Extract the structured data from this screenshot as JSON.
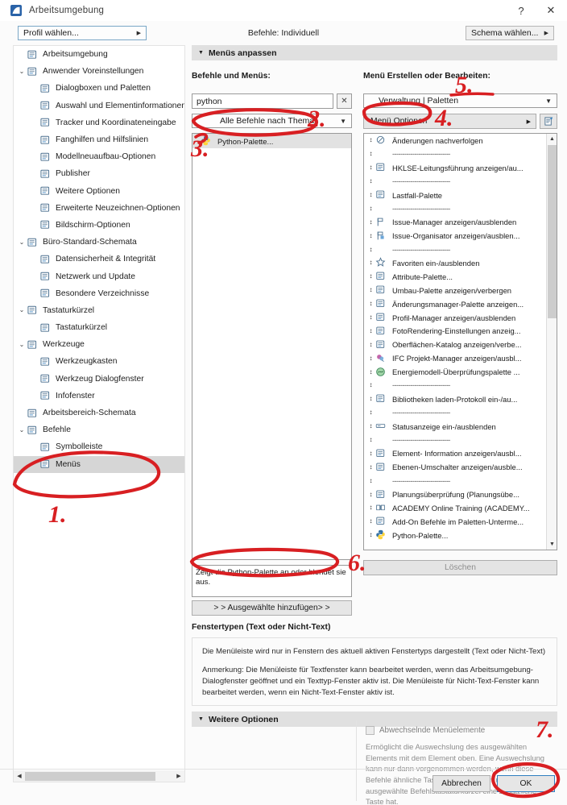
{
  "window": {
    "title": "Arbeitsumgebung",
    "icon": "archicad-app-icon",
    "help_label": "?",
    "close_label": "✕"
  },
  "topbar": {
    "profile_button": "Profil wählen...",
    "center_label": "Befehle:  Individuell",
    "schema_button": "Schema wählen..."
  },
  "tree": [
    {
      "label": "Arbeitsumgebung",
      "depth": 0,
      "twisty": "",
      "icon": "workspace-icon",
      "selected": false
    },
    {
      "label": "Anwender Voreinstellungen",
      "depth": 0,
      "twisty": "⌄",
      "icon": "user-prefs-icon",
      "selected": false
    },
    {
      "label": "Dialogboxen und Paletten",
      "depth": 1,
      "twisty": "",
      "icon": "dialogs-palettes-icon",
      "selected": false
    },
    {
      "label": "Auswahl und Elementinformationen",
      "depth": 1,
      "twisty": "",
      "icon": "selection-info-icon",
      "selected": false
    },
    {
      "label": "Tracker und Koordinateneingabe",
      "depth": 1,
      "twisty": "",
      "icon": "tracker-icon",
      "selected": false
    },
    {
      "label": "Fanghilfen und Hilfslinien",
      "depth": 1,
      "twisty": "",
      "icon": "snap-guides-icon",
      "selected": false
    },
    {
      "label": "Modellneuaufbau-Optionen",
      "depth": 1,
      "twisty": "",
      "icon": "rebuild-options-icon",
      "selected": false
    },
    {
      "label": "Publisher",
      "depth": 1,
      "twisty": "",
      "icon": "publisher-icon",
      "selected": false
    },
    {
      "label": "Weitere Optionen",
      "depth": 1,
      "twisty": "",
      "icon": "more-options-icon",
      "selected": false
    },
    {
      "label": "Erweiterte Neuzeichnen-Optionen",
      "depth": 1,
      "twisty": "",
      "icon": "advanced-redraw-icon",
      "selected": false
    },
    {
      "label": "Bildschirm-Optionen",
      "depth": 1,
      "twisty": "",
      "icon": "screen-options-icon",
      "selected": false
    },
    {
      "label": "Büro-Standard-Schemata",
      "depth": 0,
      "twisty": "⌄",
      "icon": "office-standards-icon",
      "selected": false
    },
    {
      "label": "Datensicherheit & Integrität",
      "depth": 1,
      "twisty": "",
      "icon": "data-safety-icon",
      "selected": false
    },
    {
      "label": "Netzwerk und Update",
      "depth": 1,
      "twisty": "",
      "icon": "network-update-icon",
      "selected": false
    },
    {
      "label": "Besondere Verzeichnisse",
      "depth": 1,
      "twisty": "",
      "icon": "special-folders-icon",
      "selected": false
    },
    {
      "label": "Tastaturkürzel",
      "depth": 0,
      "twisty": "⌄",
      "icon": "shortcuts-group-icon",
      "selected": false
    },
    {
      "label": "Tastaturkürzel",
      "depth": 1,
      "twisty": "",
      "icon": "shortcuts-icon",
      "selected": false
    },
    {
      "label": "Werkzeuge",
      "depth": 0,
      "twisty": "⌄",
      "icon": "tools-group-icon",
      "selected": false
    },
    {
      "label": "Werkzeugkasten",
      "depth": 1,
      "twisty": "",
      "icon": "toolbox-icon",
      "selected": false
    },
    {
      "label": "Werkzeug Dialogfenster",
      "depth": 1,
      "twisty": "",
      "icon": "tool-dialog-icon",
      "selected": false
    },
    {
      "label": "Infofenster",
      "depth": 1,
      "twisty": "",
      "icon": "info-window-icon",
      "selected": false
    },
    {
      "label": "Arbeitsbereich-Schemata",
      "depth": 0,
      "twisty": "",
      "icon": "workspace-schemes-icon",
      "selected": false
    },
    {
      "label": "Befehle",
      "depth": 0,
      "twisty": "⌄",
      "icon": "commands-group-icon",
      "selected": false
    },
    {
      "label": "Symbolleiste",
      "depth": 1,
      "twisty": "",
      "icon": "toolbar-icon",
      "selected": false
    },
    {
      "label": "Menüs",
      "depth": 1,
      "twisty": "",
      "icon": "menus-icon",
      "selected": true
    }
  ],
  "main": {
    "section_title": "Menüs anpassen",
    "left_col_title": "Befehle und Menüs:",
    "right_col_title": "Menü Erstellen oder Bearbeiten:",
    "search_value": "python",
    "search_clear_label": "✕",
    "filter_combo": "Alle Befehle nach Thema",
    "menu_combo": "Verwaltung | Paletten",
    "menu_options_button": "Menü Optionen",
    "menu_options_arrow": "▸",
    "edit_icon_name": "edit-menu-icon",
    "found_items": [
      {
        "label": "Python-Palette...",
        "icon": "python-icon",
        "selected": true
      }
    ],
    "description": "Zeigt die Python-Palette an oder blendet sie aus.",
    "add_button": "> > Ausgewählte hinzufügen> >",
    "delete_button": "Löschen",
    "window_types_title": "Fenstertypen (Text oder Nicht-Text)",
    "info_paragraphs": [
      "Die Menüleiste wird nur in Fenstern des aktuell aktiven Fenstertyps dargestellt (Text oder Nicht-Text)",
      "Anmerkung: Die Menüleiste für Textfenster kann bearbeitet werden, wenn das Arbeitsumgebung-Dialogfenster geöffnet und ein Texttyp-Fenster aktiv ist. Die Menüleiste für Nicht-Text-Fenster kann bearbeitet werden, wenn ein Nicht-Text-Fenster aktiv ist."
    ],
    "more_options_title": "Weitere Optionen",
    "alternating_checkbox": "Abwechselnde Menüelemente",
    "alternating_help": "Ermöglicht die Auswechslung des ausgewählten Elements mit dem Element oben. Eine Auswechslung kann nur dann vorgenommen werden, wenn diese Befehle ähnliche Tastaturkürzel haben und das ausgewählte Befehlstastaturkürzel eine zusätzliche Taste hat."
  },
  "menu_items": [
    {
      "label": "Änderungen nachverfolgen",
      "icon": "track-changes-icon",
      "separator": false
    },
    {
      "label": "-----------------------------",
      "icon": "",
      "separator": true
    },
    {
      "label": "HKLSE-Leitungsführung anzeigen/au...",
      "icon": "mep-routing-icon",
      "separator": false
    },
    {
      "label": "-----------------------------",
      "icon": "",
      "separator": true
    },
    {
      "label": "Lastfall-Palette",
      "icon": "load-case-icon",
      "separator": false
    },
    {
      "label": "-----------------------------",
      "icon": "",
      "separator": true
    },
    {
      "label": "Issue-Manager anzeigen/ausblenden",
      "icon": "issue-manager-icon",
      "separator": false
    },
    {
      "label": "Issue-Organisator anzeigen/ausblen...",
      "icon": "issue-organizer-icon",
      "separator": false
    },
    {
      "label": "-----------------------------",
      "icon": "",
      "separator": true
    },
    {
      "label": "Favoriten ein-/ausblenden",
      "icon": "favorites-star-icon",
      "separator": false
    },
    {
      "label": "Attribute-Palette...",
      "icon": "attributes-icon",
      "separator": false
    },
    {
      "label": "Umbau-Palette anzeigen/verbergen",
      "icon": "renovation-icon",
      "separator": false
    },
    {
      "label": "Änderungsmanager-Palette anzeigen...",
      "icon": "change-manager-icon",
      "separator": false
    },
    {
      "label": "Profil-Manager anzeigen/ausblenden",
      "icon": "profile-manager-icon",
      "separator": false
    },
    {
      "label": "FotoRendering-Einstellungen anzeig...",
      "icon": "photorendering-icon",
      "separator": false
    },
    {
      "label": "Oberflächen-Katalog anzeigen/verbe...",
      "icon": "surface-catalog-icon",
      "separator": false
    },
    {
      "label": "IFC Projekt-Manager anzeigen/ausbl...",
      "icon": "ifc-manager-icon",
      "separator": false
    },
    {
      "label": "Energiemodell-Überprüfungspalette ...",
      "icon": "energy-model-icon",
      "separator": false
    },
    {
      "label": "-----------------------------",
      "icon": "",
      "separator": true
    },
    {
      "label": "Bibliotheken laden-Protokoll ein-/au...",
      "icon": "library-log-icon",
      "separator": false
    },
    {
      "label": "-----------------------------",
      "icon": "",
      "separator": true
    },
    {
      "label": "Statusanzeige ein-/ausblenden",
      "icon": "status-bar-icon",
      "separator": false
    },
    {
      "label": "-----------------------------",
      "icon": "",
      "separator": true
    },
    {
      "label": "Element- Information anzeigen/ausbl...",
      "icon": "element-info-icon",
      "separator": false
    },
    {
      "label": "Ebenen-Umschalter anzeigen/ausble...",
      "icon": "layer-switcher-icon",
      "separator": false
    },
    {
      "label": "-----------------------------",
      "icon": "",
      "separator": true
    },
    {
      "label": "Planungsüberprüfung (Planungsübe...",
      "icon": "design-check-icon",
      "separator": false
    },
    {
      "label": "ACADEMY Online Training (ACADEMY...",
      "icon": "academy-icon",
      "separator": false
    },
    {
      "label": "Add-On Befehle im Paletten-Unterme...",
      "icon": "addon-commands-icon",
      "separator": false
    },
    {
      "label": "Python-Palette...",
      "icon": "python-icon",
      "separator": false
    }
  ],
  "footer": {
    "cancel_button": "Abbrechen",
    "ok_button": "OK"
  },
  "annotations": [
    {
      "number": "1.",
      "target": "menus-tree-item"
    },
    {
      "number": "2.",
      "target": "filter-combo"
    },
    {
      "number": "3.",
      "target": "python-palette-result"
    },
    {
      "number": "4.",
      "target": "menu-options-button"
    },
    {
      "number": "5.",
      "target": "menu-combo"
    },
    {
      "number": "6.",
      "target": "add-selected-button"
    },
    {
      "number": "7.",
      "target": "alternating-help-text"
    },
    {
      "number": "",
      "target": "ok-button"
    }
  ],
  "colors": {
    "annotation_red": "#d81f22",
    "selection_gray": "#d6d6d6",
    "accent_blue": "#2f7ec0",
    "header_gray": "#e0e0e0"
  }
}
